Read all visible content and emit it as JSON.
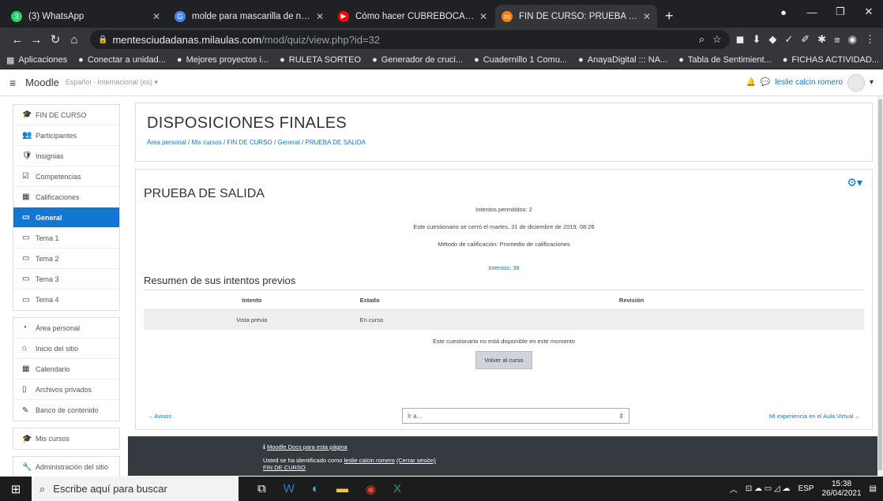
{
  "browser": {
    "tabs": [
      {
        "title": "(3) WhatsApp",
        "favicon_color": "#25d366",
        "favicon": "3"
      },
      {
        "title": "molde para mascarilla de niños -",
        "favicon_color": "#4285f4",
        "favicon": "G"
      },
      {
        "title": "Cómo hacer CUBREBOCAS para",
        "favicon_color": "#ff0000",
        "favicon": "▶"
      },
      {
        "title": "FIN DE CURSO: PRUEBA DE SALI",
        "favicon_color": "#f98012",
        "favicon": "m",
        "active": true
      }
    ],
    "new_tab": "+",
    "url_host": "mentesciudadanas.milaulas.com",
    "url_path": "/mod/quiz/view.php?id=32",
    "bookmarks": [
      "Aplicaciones",
      "Conectar a unidad...",
      "Mejores proyectos i...",
      "RULETA SORTEO",
      "Generador de cruci...",
      "Cuadernillo 1 Comu...",
      "AnayaDigital ::: NA...",
      "Tabla de Sentimient...",
      "FICHAS ACTIVIDAD..."
    ]
  },
  "navbar": {
    "brand": "Moodle",
    "language": "Español - Internacional (es) ▾",
    "user": "leslie calcin romero"
  },
  "sidebar": {
    "course_items": [
      {
        "label": "FIN DE CURSO",
        "icon": "🎓"
      },
      {
        "label": "Participantes",
        "icon": "👥"
      },
      {
        "label": "Insignias",
        "icon": "🛡"
      },
      {
        "label": "Competencias",
        "icon": "☑"
      },
      {
        "label": "Calificaciones",
        "icon": "▦"
      },
      {
        "label": "General",
        "icon": "▭",
        "active": true
      },
      {
        "label": "Tema 1",
        "icon": "▭"
      },
      {
        "label": "Tema 2",
        "icon": "▭"
      },
      {
        "label": "Tema 3",
        "icon": "▭"
      },
      {
        "label": "Tema 4",
        "icon": "▭"
      }
    ],
    "site_items": [
      {
        "label": "Área personal",
        "icon": "◔"
      },
      {
        "label": "Inicio del sitio",
        "icon": "⌂"
      },
      {
        "label": "Calendario",
        "icon": "▦"
      },
      {
        "label": "Archivos privados",
        "icon": "▯"
      },
      {
        "label": "Banco de contenido",
        "icon": "✎"
      }
    ],
    "my_courses": {
      "label": "Mis cursos",
      "icon": "🎓"
    },
    "admin": {
      "label": "Administración del sitio",
      "icon": "🔧"
    }
  },
  "header": {
    "title": "DISPOSICIONES FINALES",
    "breadcrumb": [
      "Área personal",
      "Mis cursos",
      "FIN DE CURSO",
      "General",
      "PRUEBA DE SALIDA"
    ]
  },
  "quiz": {
    "title": "PRUEBA DE SALIDA",
    "attempts_allowed": "Intentos permitidos: 2",
    "closed": "Este cuestionario se cerró el martes, 31 de diciembre de 2019, 08:26",
    "grading": "Método de calificación: Promedio de calificaciones",
    "attempts_link": "Intentos: 39",
    "summary_title": "Resumen de sus intentos previos",
    "columns": [
      "Intento",
      "Estado",
      "Revisión"
    ],
    "rows": [
      {
        "intento": "Vista previa",
        "estado": "En curso",
        "revision": ""
      }
    ],
    "not_available": "Este cuestionario no está disponible en este momento",
    "back_button": "Volver al curso",
    "prev_link": "→ Avisos",
    "jump_placeholder": "Ir a...",
    "next_link": "Mi experiencia en el Aula Virtual ←"
  },
  "footer": {
    "docs_link": "Moodle Docs para esta página",
    "logged_prefix": "Usted se ha identificado como",
    "logged_user": "leslie calcin romero",
    "logout": "(Cerrar sesión)",
    "course_link": "FIN DE CURSO"
  },
  "taskbar": {
    "search_placeholder": "Escribe aquí para buscar",
    "lang": "ESP",
    "time": "15:38",
    "date": "26/04/2021"
  }
}
